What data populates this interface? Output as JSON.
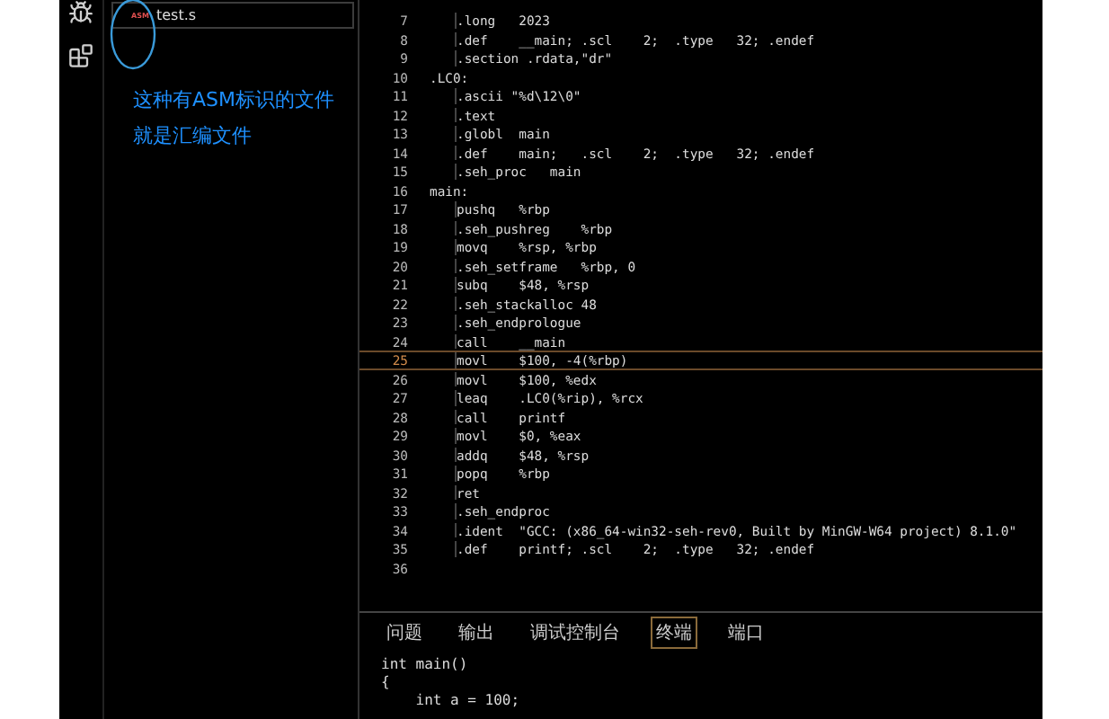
{
  "explorer": {
    "file": {
      "icon_label": "ASM",
      "name": "test.s"
    },
    "annotation": [
      "这种有ASM标识的文件",
      "就是汇编文件"
    ]
  },
  "editor": {
    "lines": [
      {
        "number": "7",
        "kind": "instr",
        "text": ".long   2023",
        "current": false
      },
      {
        "number": "8",
        "kind": "instr",
        "text": ".def    __main; .scl    2;  .type   32; .endef",
        "current": false
      },
      {
        "number": "9",
        "kind": "instr",
        "text": ".section .rdata,\"dr\"",
        "current": false
      },
      {
        "number": "10",
        "kind": "label",
        "text": ".LC0:",
        "current": false
      },
      {
        "number": "11",
        "kind": "instr",
        "text": ".ascii \"%d\\12\\0\"",
        "current": false
      },
      {
        "number": "12",
        "kind": "instr",
        "text": ".text",
        "current": false
      },
      {
        "number": "13",
        "kind": "instr",
        "text": ".globl  main",
        "current": false
      },
      {
        "number": "14",
        "kind": "instr",
        "text": ".def    main;   .scl    2;  .type   32; .endef",
        "current": false
      },
      {
        "number": "15",
        "kind": "instr",
        "text": ".seh_proc   main",
        "current": false
      },
      {
        "number": "16",
        "kind": "label",
        "text": "main:",
        "current": false
      },
      {
        "number": "17",
        "kind": "instr",
        "text": "pushq   %rbp",
        "current": false
      },
      {
        "number": "18",
        "kind": "instr",
        "text": ".seh_pushreg    %rbp",
        "current": false
      },
      {
        "number": "19",
        "kind": "instr",
        "text": "movq    %rsp, %rbp",
        "current": false
      },
      {
        "number": "20",
        "kind": "instr",
        "text": ".seh_setframe   %rbp, 0",
        "current": false
      },
      {
        "number": "21",
        "kind": "instr",
        "text": "subq    $48, %rsp",
        "current": false
      },
      {
        "number": "22",
        "kind": "instr",
        "text": ".seh_stackalloc 48",
        "current": false
      },
      {
        "number": "23",
        "kind": "instr",
        "text": ".seh_endprologue",
        "current": false
      },
      {
        "number": "24",
        "kind": "instr",
        "text": "call    __main",
        "current": false
      },
      {
        "number": "25",
        "kind": "instr",
        "text": "movl    $100, -4(%rbp)",
        "current": true
      },
      {
        "number": "26",
        "kind": "instr",
        "text": "movl    $100, %edx",
        "current": false
      },
      {
        "number": "27",
        "kind": "instr",
        "text": "leaq    .LC0(%rip), %rcx",
        "current": false
      },
      {
        "number": "28",
        "kind": "instr",
        "text": "call    printf",
        "current": false
      },
      {
        "number": "29",
        "kind": "instr",
        "text": "movl    $0, %eax",
        "current": false
      },
      {
        "number": "30",
        "kind": "instr",
        "text": "addq    $48, %rsp",
        "current": false
      },
      {
        "number": "31",
        "kind": "instr",
        "text": "popq    %rbp",
        "current": false
      },
      {
        "number": "32",
        "kind": "instr",
        "text": "ret",
        "current": false
      },
      {
        "number": "33",
        "kind": "instr",
        "text": ".seh_endproc",
        "current": false
      },
      {
        "number": "34",
        "kind": "instr",
        "text": ".ident  \"GCC: (x86_64-win32-seh-rev0, Built by MinGW-W64 project) 8.1.0\"",
        "current": false
      },
      {
        "number": "35",
        "kind": "instr",
        "text": ".def    printf; .scl    2;  .type   32; .endef",
        "current": false
      },
      {
        "number": "36",
        "kind": "blank",
        "current": false
      }
    ]
  },
  "panel": {
    "tabs": [
      {
        "label": "问题",
        "selected": false
      },
      {
        "label": "输出",
        "selected": false
      },
      {
        "label": "调试控制台",
        "selected": false
      },
      {
        "label": "终端",
        "selected": true
      },
      {
        "label": "端口",
        "selected": false
      }
    ],
    "terminal_lines": [
      "int main()",
      "{",
      "    int a = 100;"
    ]
  }
}
